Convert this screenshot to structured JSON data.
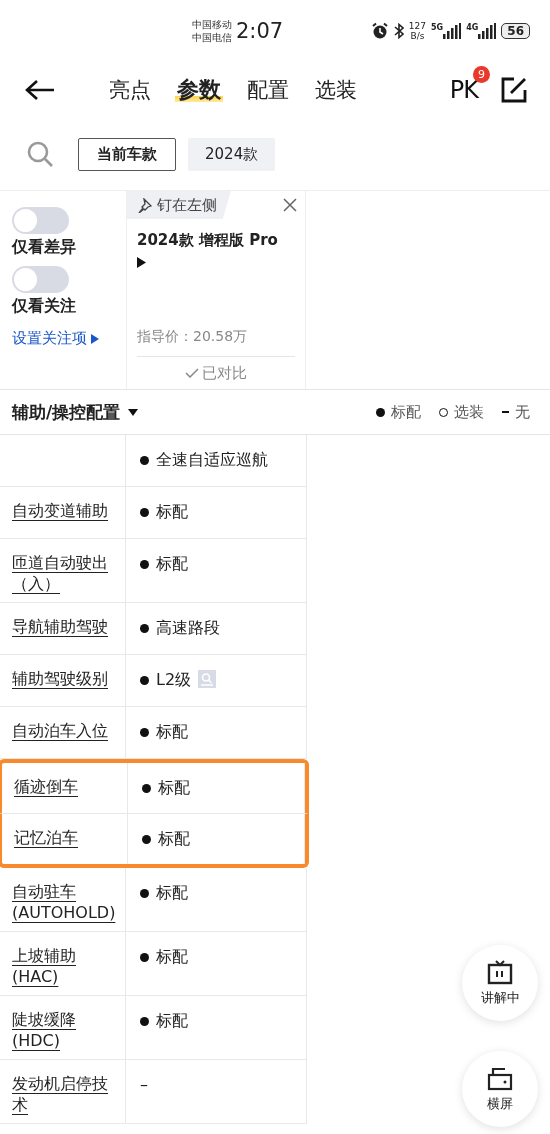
{
  "status_bar": {
    "carriers": [
      "中国移动",
      "中国电信"
    ],
    "time": "2:07",
    "speed": [
      "127",
      "B/s"
    ],
    "networks": [
      "5G",
      "4G"
    ],
    "battery": "56"
  },
  "nav": {
    "tabs": [
      {
        "label": "亮点",
        "selected": false
      },
      {
        "label": "参数",
        "selected": true
      },
      {
        "label": "配置",
        "selected": false
      },
      {
        "label": "选装",
        "selected": false
      }
    ],
    "pk": "PK",
    "pk_badge": "9"
  },
  "filters": [
    {
      "label": "当前车款",
      "selected": true
    },
    {
      "label": "2024款",
      "selected": false
    }
  ],
  "toggles": [
    {
      "label": "仅看差异",
      "on": false
    },
    {
      "label": "仅看关注",
      "on": false
    }
  ],
  "focus_link": "设置关注项",
  "car": {
    "pin": "钉在左侧",
    "name": "2024款 增程版 Pro",
    "price": "指导价：20.58万",
    "compared": "已对比"
  },
  "section": {
    "title": "辅助/操控配置",
    "legend": [
      "标配",
      "选装",
      "无"
    ]
  },
  "rows": [
    {
      "label": "",
      "value": "全速自适应巡航",
      "dot": true,
      "search": false,
      "highlighted": false
    },
    {
      "label": "自动变道辅助",
      "value": "标配",
      "dot": true,
      "search": false,
      "highlighted": false
    },
    {
      "label": "匝道自动驶出（入）",
      "value": "标配",
      "dot": true,
      "search": false,
      "highlighted": false
    },
    {
      "label": "导航辅助驾驶",
      "value": "高速路段",
      "dot": true,
      "search": false,
      "highlighted": false
    },
    {
      "label": "辅助驾驶级别",
      "value": "L2级",
      "dot": true,
      "search": true,
      "highlighted": false
    },
    {
      "label": "自动泊车入位",
      "value": "标配",
      "dot": true,
      "search": false,
      "highlighted": false
    },
    {
      "label": "循迹倒车",
      "value": "标配",
      "dot": true,
      "search": false,
      "highlighted": true
    },
    {
      "label": "记忆泊车",
      "value": "标配",
      "dot": true,
      "search": false,
      "highlighted": true
    },
    {
      "label": "自动驻车(AUTOHOLD)",
      "value": "标配",
      "dot": true,
      "search": false,
      "highlighted": false
    },
    {
      "label": "上坡辅助(HAC)",
      "value": "标配",
      "dot": true,
      "search": false,
      "highlighted": false
    },
    {
      "label": "陡坡缓降(HDC)",
      "value": "标配",
      "dot": true,
      "search": false,
      "highlighted": false
    },
    {
      "label": "发动机启停技术",
      "value": "–",
      "dot": false,
      "search": false,
      "highlighted": false
    }
  ],
  "floating": [
    {
      "label": "讲解中",
      "kind": "tv"
    },
    {
      "label": "横屏",
      "kind": "rotate"
    }
  ]
}
